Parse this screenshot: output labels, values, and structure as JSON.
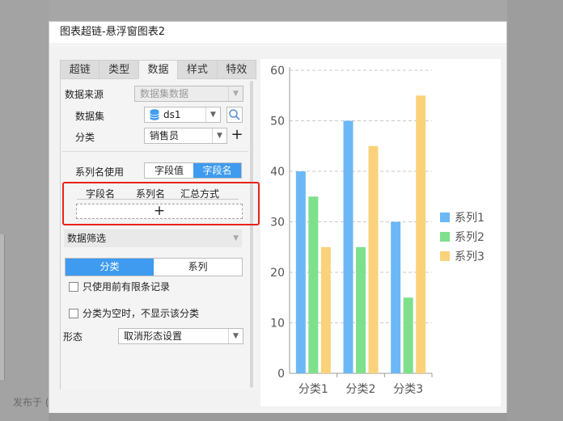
{
  "background": {
    "footer_text": "发布于 ("
  },
  "dialog": {
    "title": "图表超链-悬浮窗图表2"
  },
  "tabs": [
    {
      "label": "超链",
      "active": false
    },
    {
      "label": "类型",
      "active": false
    },
    {
      "label": "数据",
      "active": true
    },
    {
      "label": "样式",
      "active": false
    },
    {
      "label": "特效",
      "active": false
    }
  ],
  "data_source": {
    "label": "数据来源",
    "value": "数据集数据",
    "dataset_label": "数据集",
    "dataset_value": "ds1",
    "category_label": "分类",
    "category_value": "销售员"
  },
  "series_name": {
    "label": "系列名使用",
    "options": [
      {
        "label": "字段值",
        "active": false
      },
      {
        "label": "字段名",
        "active": true
      }
    ],
    "table_headers": [
      "字段名",
      "系列名",
      "汇总方式"
    ],
    "add_symbol": "+"
  },
  "filter": {
    "label": "数据筛选",
    "tabs": [
      {
        "label": "分类",
        "active": true
      },
      {
        "label": "系列",
        "active": false
      }
    ],
    "only_top_records": "只使用前有限条记录",
    "hide_empty_category": "分类为空时，不显示该分类"
  },
  "shape": {
    "label": "形态",
    "value": "取消形态设置"
  },
  "colors": {
    "accent": "#3e9bf0",
    "highlight": "#e8231c",
    "series": [
      "#6cb8f5",
      "#7ee08c",
      "#fad27a"
    ]
  },
  "chart_data": {
    "type": "bar",
    "categories": [
      "分类1",
      "分类2",
      "分类3"
    ],
    "series": [
      {
        "name": "系列1",
        "values": [
          40,
          50,
          30
        ]
      },
      {
        "name": "系列2",
        "values": [
          35,
          25,
          15
        ]
      },
      {
        "name": "系列3",
        "values": [
          25,
          45,
          55
        ]
      }
    ],
    "ylim": [
      0,
      60
    ],
    "yticks": [
      0,
      10,
      20,
      30,
      40,
      50,
      60
    ],
    "grid": true,
    "legend": "right"
  }
}
